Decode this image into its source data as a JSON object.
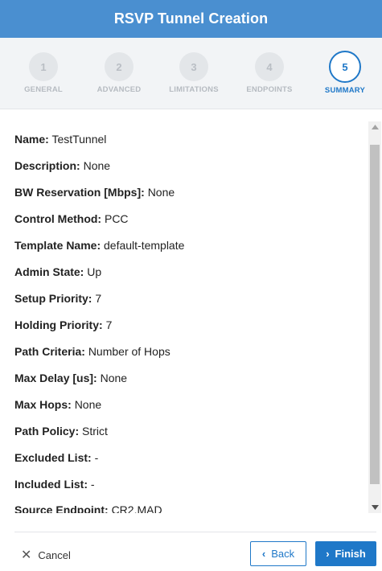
{
  "window": {
    "title": "RSVP Tunnel Creation"
  },
  "steps": [
    {
      "number": "1",
      "label": "GENERAL"
    },
    {
      "number": "2",
      "label": "ADVANCED"
    },
    {
      "number": "3",
      "label": "LIMITATIONS"
    },
    {
      "number": "4",
      "label": "ENDPOINTS"
    },
    {
      "number": "5",
      "label": "SUMMARY"
    }
  ],
  "active_step": 5,
  "summary": [
    {
      "label": "Name:",
      "value": "TestTunnel"
    },
    {
      "label": "Description:",
      "value": "None"
    },
    {
      "label": "BW Reservation [Mbps]:",
      "value": "None"
    },
    {
      "label": "Control Method:",
      "value": "PCC"
    },
    {
      "label": "Template Name:",
      "value": "default-template"
    },
    {
      "label": "Admin State:",
      "value": "Up"
    },
    {
      "label": "Setup Priority:",
      "value": "7"
    },
    {
      "label": "Holding Priority:",
      "value": "7"
    },
    {
      "label": "Path Criteria:",
      "value": "Number of Hops"
    },
    {
      "label": "Max Delay [us]:",
      "value": "None"
    },
    {
      "label": "Max Hops:",
      "value": "None"
    },
    {
      "label": "Path Policy:",
      "value": "Strict"
    },
    {
      "label": "Excluded List:",
      "value": "-"
    },
    {
      "label": "Included List:",
      "value": "-"
    },
    {
      "label": "Source Endpoint:",
      "value": "CR2.MAD"
    }
  ],
  "footer": {
    "cancel_label": "Cancel",
    "back_label": "Back",
    "finish_label": "Finish"
  },
  "icons": {
    "cancel": "close-icon",
    "back": "chevron-left-icon",
    "finish": "chevron-right-icon",
    "scroll_up": "triangle-up-icon",
    "scroll_down": "triangle-down-icon"
  },
  "colors": {
    "header": "#4a8fd0",
    "accent": "#1f78c8",
    "inactive_step": "#b6bbc1"
  }
}
